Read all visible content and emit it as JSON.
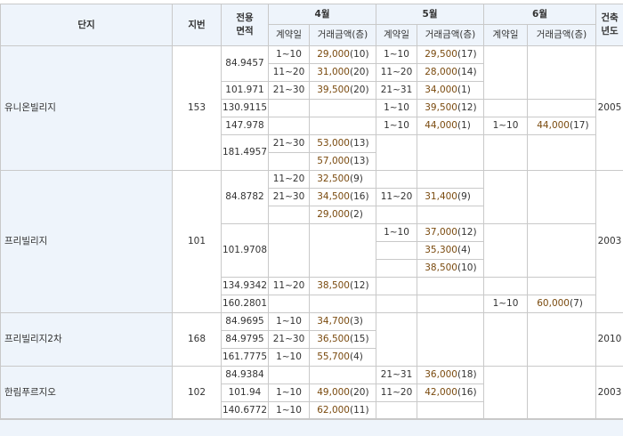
{
  "header": {
    "complex": "단지",
    "lot": "지번",
    "area_line1": "전용",
    "area_line2": "면적",
    "months": [
      "4월",
      "5월",
      "6월"
    ],
    "contract_date": "계약일",
    "trade_amount": "거래금액(층)",
    "built_line1": "건축",
    "built_line2": "년도"
  },
  "rows": [
    {
      "complex": "유니온빌리지",
      "lot": "153",
      "area": "84.9457",
      "m4d": "1~10",
      "m4a": "29,000",
      "m4f": "(10)",
      "m5d": "1~10",
      "m5a": "29,500",
      "m5f": "(17)",
      "m6d": "",
      "m6a": "",
      "m6f": "",
      "built": "2005"
    },
    {
      "m4d": "11~20",
      "m4a": "31,000",
      "m4f": "(20)",
      "m5d": "11~20",
      "m5a": "28,000",
      "m5f": "(14)",
      "m6d": "",
      "m6a": "",
      "m6f": ""
    },
    {
      "area": "101.971",
      "m4d": "21~30",
      "m4a": "39,500",
      "m4f": "(20)",
      "m5d": "21~31",
      "m5a": "34,000",
      "m5f": "(1)",
      "m6d": "",
      "m6a": "",
      "m6f": ""
    },
    {
      "area": "130.9115",
      "m4d": "",
      "m4a": "",
      "m4f": "",
      "m5d": "1~10",
      "m5a": "39,500",
      "m5f": "(12)",
      "m6d": "",
      "m6a": "",
      "m6f": ""
    },
    {
      "area": "147.978",
      "m4d": "",
      "m4a": "",
      "m4f": "",
      "m5d": "1~10",
      "m5a": "44,000",
      "m5f": "(1)",
      "m6d": "1~10",
      "m6a": "44,000",
      "m6f": "(17)"
    },
    {
      "area": "181.4957",
      "m4d": "21~30",
      "m4a": "53,000",
      "m4f": "(13)",
      "m5d": "",
      "m5a": "",
      "m5f": "",
      "m6d": "",
      "m6a": "",
      "m6f": ""
    },
    {
      "m4d": "",
      "m4a": "57,000",
      "m4f": "(13)"
    },
    {
      "complex": "프리빌리지",
      "lot": "101",
      "area": "84.8782",
      "m4d": "11~20",
      "m4a": "32,500",
      "m4f": "(9)",
      "m5d": "",
      "m5a": "",
      "m5f": "",
      "m6d": "",
      "m6a": "",
      "m6f": "",
      "built": "2003"
    },
    {
      "m4d": "21~30",
      "m4a": "34,500",
      "m4f": "(16)",
      "m5d": "11~20",
      "m5a": "31,400",
      "m5f": "(9)"
    },
    {
      "m4d": "",
      "m4a": "29,000",
      "m4f": "(2)"
    },
    {
      "area": "101.9708",
      "m4d": "",
      "m4a": "",
      "m4f": "",
      "m5d": "1~10",
      "m5a": "37,000",
      "m5f": "(12)",
      "m6d": "",
      "m6a": "",
      "m6f": ""
    },
    {
      "m5d": "",
      "m5a": "35,300",
      "m5f": "(4)"
    },
    {
      "m5d": "",
      "m5a": "38,500",
      "m5f": "(10)"
    },
    {
      "area": "134.9342",
      "m4d": "11~20",
      "m4a": "38,500",
      "m4f": "(12)",
      "m5d": "",
      "m5a": "",
      "m5f": "",
      "m6d": "",
      "m6a": "",
      "m6f": ""
    },
    {
      "area": "160.2801",
      "m4d": "",
      "m4a": "",
      "m4f": "",
      "m5d": "",
      "m5a": "",
      "m5f": "",
      "m6d": "1~10",
      "m6a": "60,000",
      "m6f": "(7)"
    },
    {
      "complex": "프리빌리지2차",
      "lot": "168",
      "area": "84.9695",
      "m4d": "1~10",
      "m4a": "34,700",
      "m4f": "(3)",
      "m5d": "",
      "m5a": "",
      "m5f": "",
      "m6d": "",
      "m6a": "",
      "m6f": "",
      "built": "2010"
    },
    {
      "area": "84.9795",
      "m4d": "21~30",
      "m4a": "36,500",
      "m4f": "(15)"
    },
    {
      "area": "161.7775",
      "m4d": "1~10",
      "m4a": "55,700",
      "m4f": "(4)"
    },
    {
      "complex": "한림푸르지오",
      "lot": "102",
      "area": "84.9384",
      "m4d": "",
      "m4a": "",
      "m4f": "",
      "m5d": "21~31",
      "m5a": "36,000",
      "m5f": "(18)",
      "m6d": "",
      "m6a": "",
      "m6f": "",
      "built": "2003"
    },
    {
      "area": "101.94",
      "m4d": "1~10",
      "m4a": "49,000",
      "m4f": "(20)",
      "m5d": "11~20",
      "m5a": "42,000",
      "m5f": "(16)"
    },
    {
      "area": "140.6772",
      "m4d": "1~10",
      "m4a": "62,000",
      "m4f": "(11)"
    }
  ]
}
